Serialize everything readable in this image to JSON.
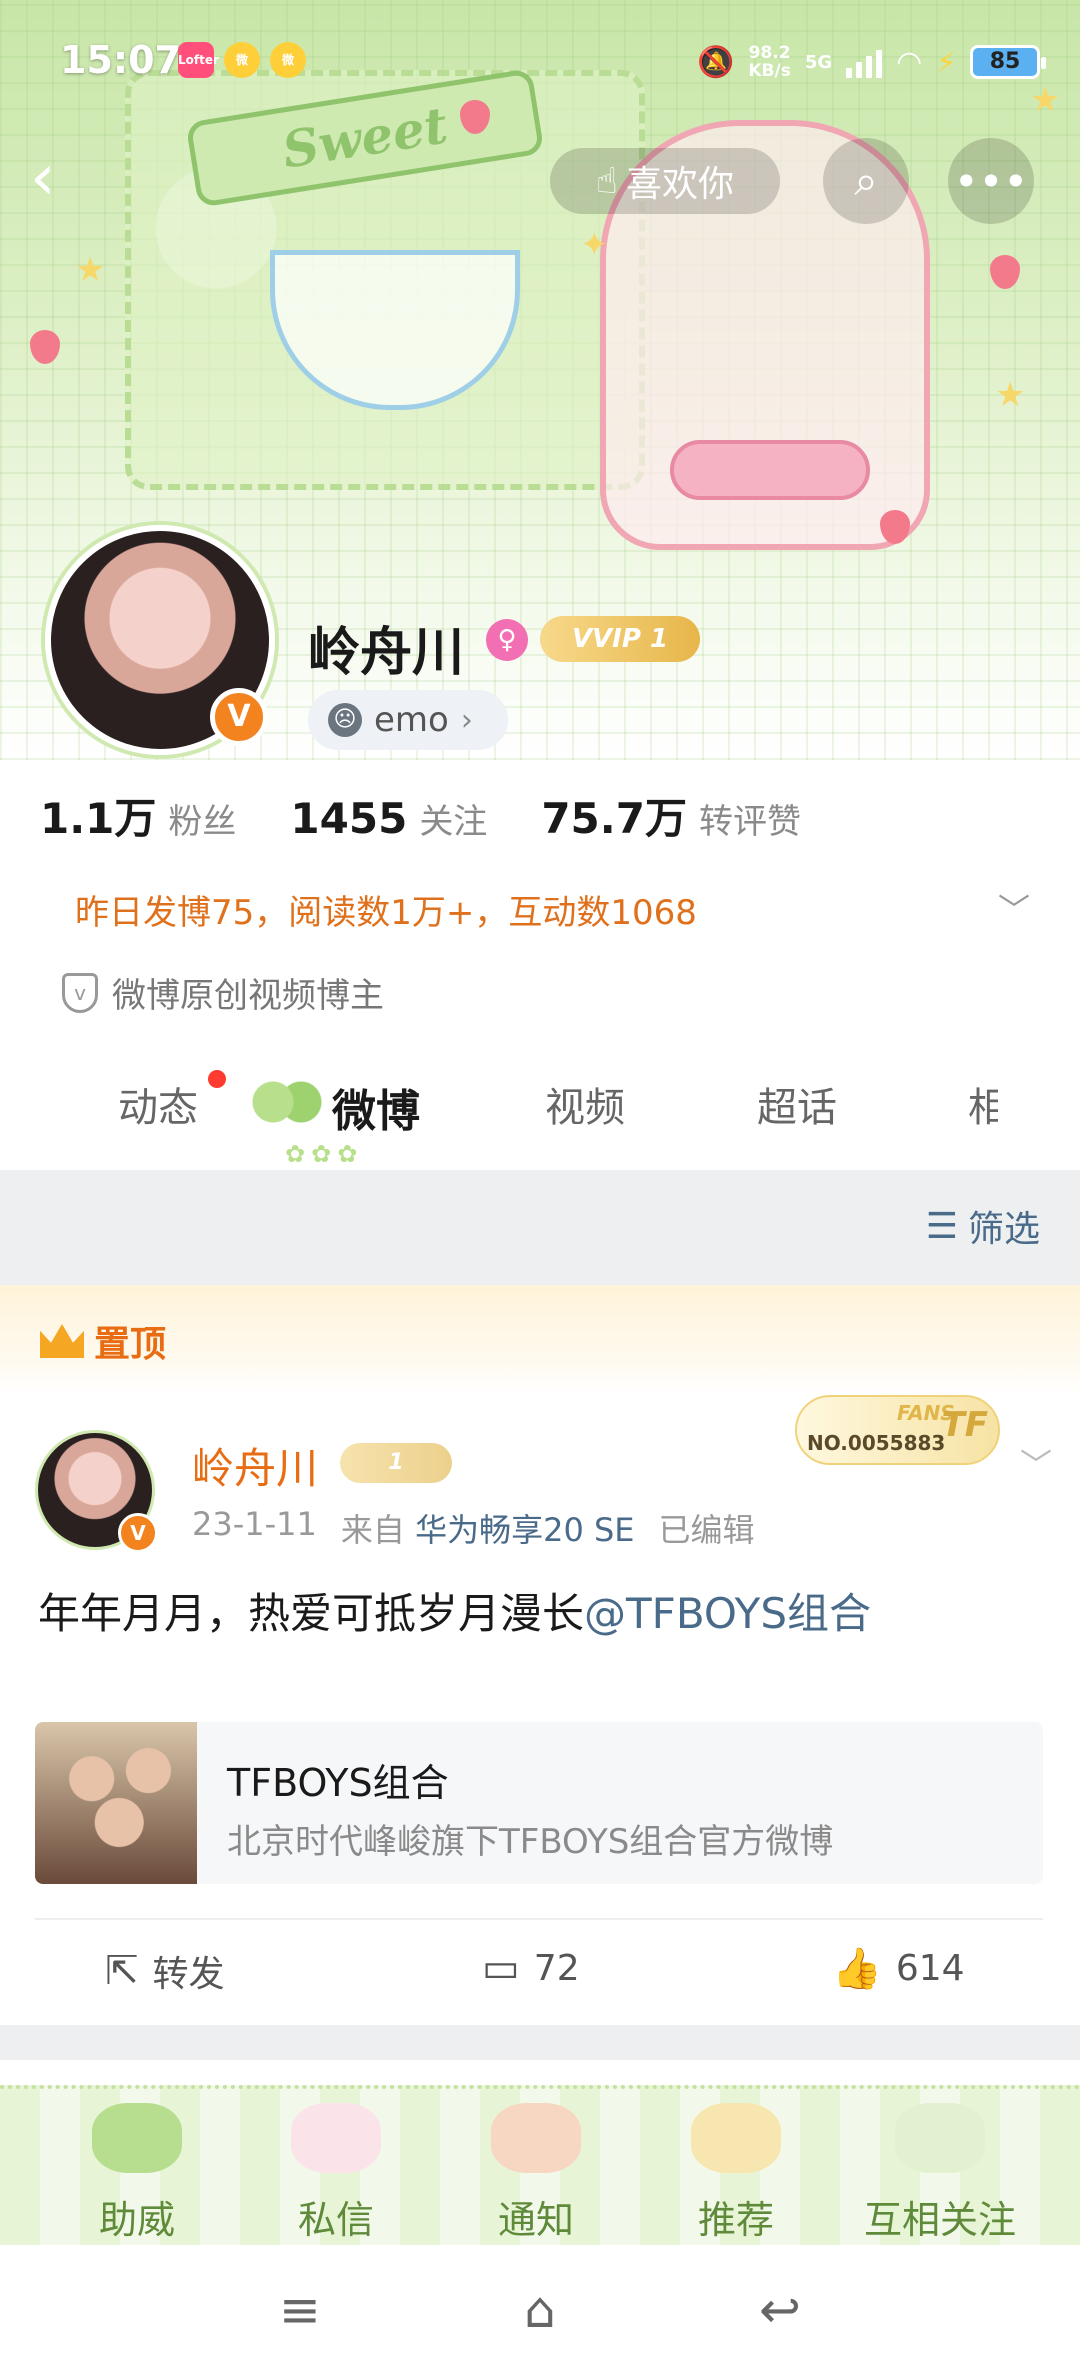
{
  "status_bar": {
    "time": "15:07",
    "net_speed": "98.2\nKB/s",
    "network": "5G",
    "battery": "85",
    "app_icons": [
      "lofter-icon",
      "weibo-icon",
      "weibo-icon"
    ]
  },
  "nav": {
    "like_label": "喜欢你"
  },
  "banner": {
    "ribbon_text": "Sweet"
  },
  "profile": {
    "name": "岭舟川",
    "vip_label": "VVIP 1",
    "verify_mark": "V",
    "mood": "emo",
    "stats": [
      {
        "num": "1.1万",
        "label": "粉丝"
      },
      {
        "num": "1455",
        "label": "关注"
      },
      {
        "num": "75.7万",
        "label": "转评赞"
      }
    ],
    "activity": "昨日发博75，阅读数1万+，互动数1068",
    "certification": "微博原创视频博主"
  },
  "tabs": [
    "动态",
    "微博",
    "视频",
    "超话",
    "相"
  ],
  "filter_label": "筛选",
  "pinned": {
    "label": "置顶",
    "fans_badge": {
      "title": "FANS",
      "number": "NO.0055883",
      "logo": "TF"
    }
  },
  "post": {
    "author": "岭舟川",
    "vip_label": "1",
    "date": "23-1-11",
    "source_prefix": "来自",
    "device": "华为畅享20 SE",
    "edited": "已编辑",
    "text_main": "年年月月，热爱可抵岁月漫长",
    "mention": "@TFBOYS组合",
    "link_card": {
      "title": "TFBOYS组合",
      "desc": "北京时代峰峻旗下TFBOYS组合官方微博"
    },
    "actions": {
      "repost_label": "转发",
      "comments": "72",
      "likes": "614"
    }
  },
  "bottom_tabs": [
    "助威",
    "私信",
    "通知",
    "推荐",
    "互相关注"
  ]
}
